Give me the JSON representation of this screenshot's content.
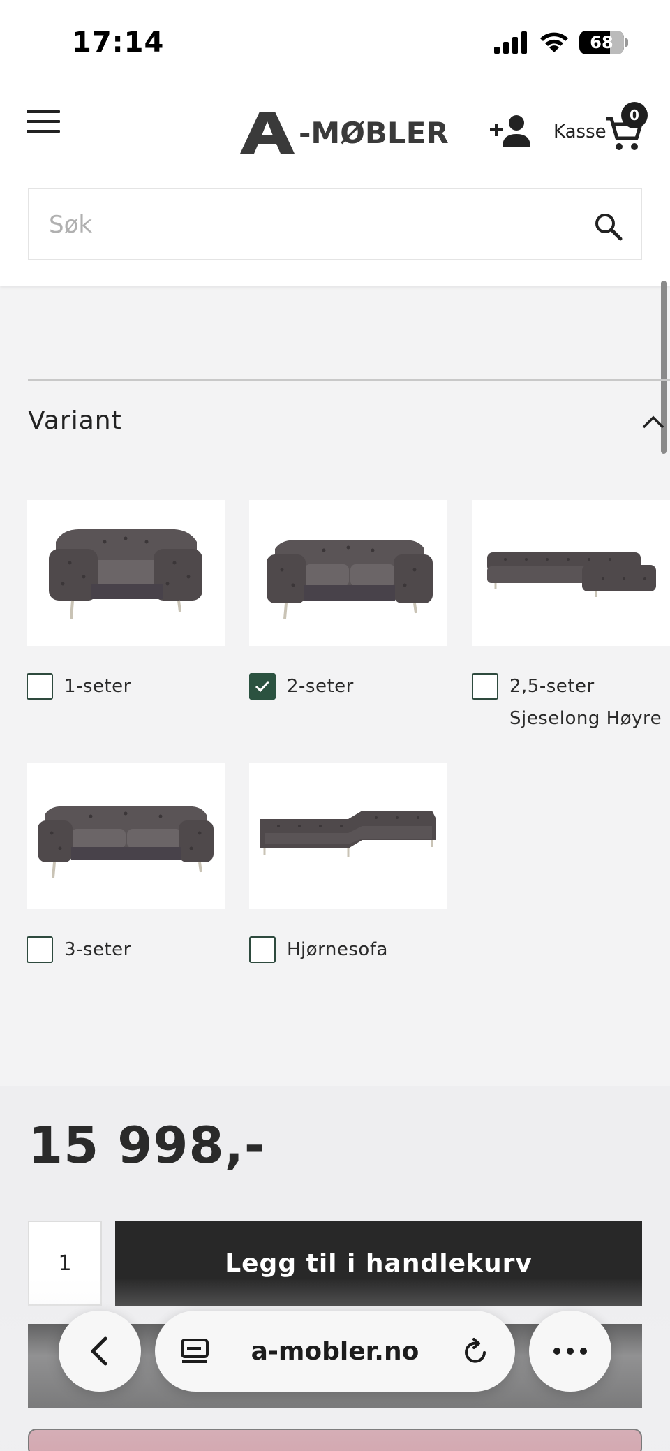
{
  "status_bar": {
    "time": "17:14",
    "battery": "68",
    "icons": [
      "cellular-signal-icon",
      "wifi-icon",
      "battery-icon"
    ]
  },
  "header": {
    "logo_text": "-MØBLER",
    "kasse_label": "Kasse",
    "cart_count": "0",
    "icons": [
      "hamburger-menu-icon",
      "add-account-icon",
      "cart-icon"
    ]
  },
  "search": {
    "placeholder": "Søk",
    "value": ""
  },
  "variant_section": {
    "title": "Variant",
    "expanded": true,
    "options": [
      {
        "label": "1-seter",
        "checked": false
      },
      {
        "label": "2-seter",
        "checked": true
      },
      {
        "label": "2,5-seter Sjeselong Høyre",
        "checked": false
      },
      {
        "label": "3-seter",
        "checked": false
      },
      {
        "label": "Hjørnesofa",
        "checked": false
      }
    ]
  },
  "purchase": {
    "price": "15 998,-",
    "quantity": "1",
    "add_to_cart_label": "Legg til i handlekurv"
  },
  "browser_bar": {
    "url": "a-mobler.no",
    "icons": [
      "back-icon",
      "tabs-icon",
      "reload-icon",
      "more-icon"
    ]
  },
  "colors": {
    "accent_dark": "#282828",
    "checkbox_checked": "#2b5240",
    "page_bg": "#f3f3f4"
  }
}
